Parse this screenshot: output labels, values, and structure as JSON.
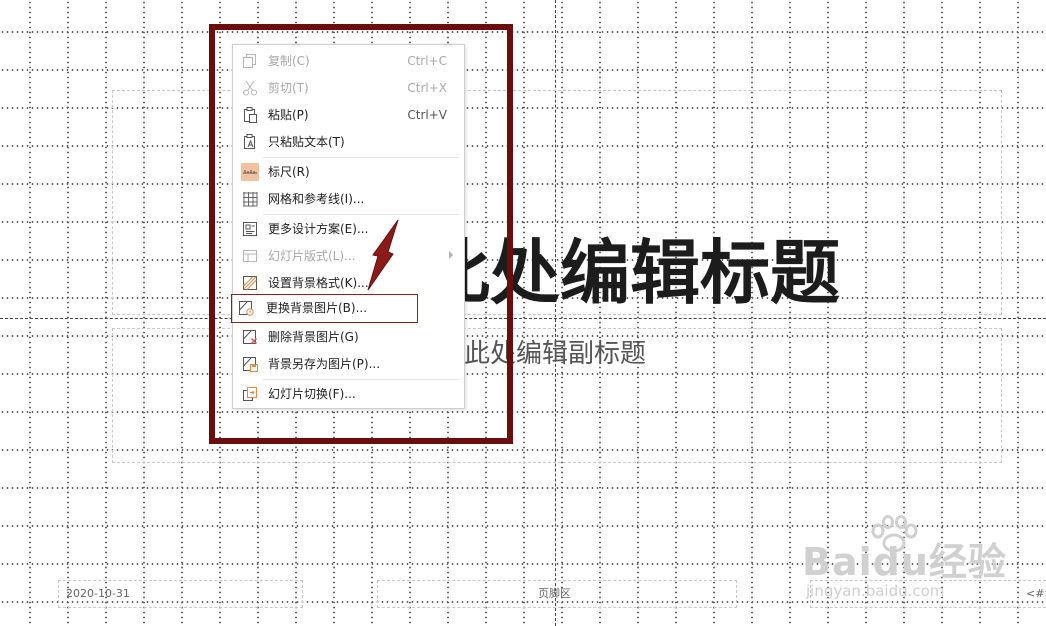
{
  "slide": {
    "title": "此处编辑标题",
    "subtitle": "击此处编辑副标题",
    "date": "2020-10-31",
    "footer": "页脚区",
    "slide_number": "<#>"
  },
  "context_menu": {
    "items": [
      {
        "label": "复制(C)",
        "shortcut": "Ctrl+C",
        "icon": "copy-icon",
        "disabled": true
      },
      {
        "label": "剪切(T)",
        "shortcut": "Ctrl+X",
        "icon": "cut-icon",
        "disabled": true
      },
      {
        "label": "粘贴(P)",
        "shortcut": "Ctrl+V",
        "icon": "paste-icon",
        "disabled": false
      },
      {
        "label": "只粘贴文本(T)",
        "shortcut": "",
        "icon": "paste-text-icon",
        "disabled": false
      },
      {
        "label": "标尺(R)",
        "shortcut": "",
        "icon": "ruler-icon",
        "disabled": false,
        "checked": true
      },
      {
        "label": "网格和参考线(I)...",
        "shortcut": "",
        "icon": "grid-icon",
        "disabled": false
      },
      {
        "label": "更多设计方案(E)...",
        "shortcut": "",
        "icon": "design-icon",
        "disabled": false
      },
      {
        "label": "幻灯片版式(L)...",
        "shortcut": "",
        "icon": "layout-icon",
        "disabled": true,
        "submenu": true
      },
      {
        "label": "设置背景格式(K)...",
        "shortcut": "",
        "icon": "background-format-icon",
        "disabled": false
      },
      {
        "label": "更换背景图片(B)...",
        "shortcut": "",
        "icon": "change-background-icon",
        "disabled": false,
        "highlighted": true
      },
      {
        "label": "删除背景图片(G)",
        "shortcut": "",
        "icon": "delete-background-icon",
        "disabled": false
      },
      {
        "label": "背景另存为图片(P)...",
        "shortcut": "",
        "icon": "save-background-icon",
        "disabled": false
      },
      {
        "label": "幻灯片切换(F)...",
        "shortcut": "",
        "icon": "transition-icon",
        "disabled": false
      }
    ]
  },
  "watermark": {
    "logo_text": "Baidu经验",
    "url": "jingyan.baidu.com"
  },
  "colors": {
    "annotation_box": "#6b0d0d",
    "arrow": "#8b1a1a",
    "ruler_highlight": "#f0c2a0",
    "menu_highlight_border": "#8b2020"
  }
}
